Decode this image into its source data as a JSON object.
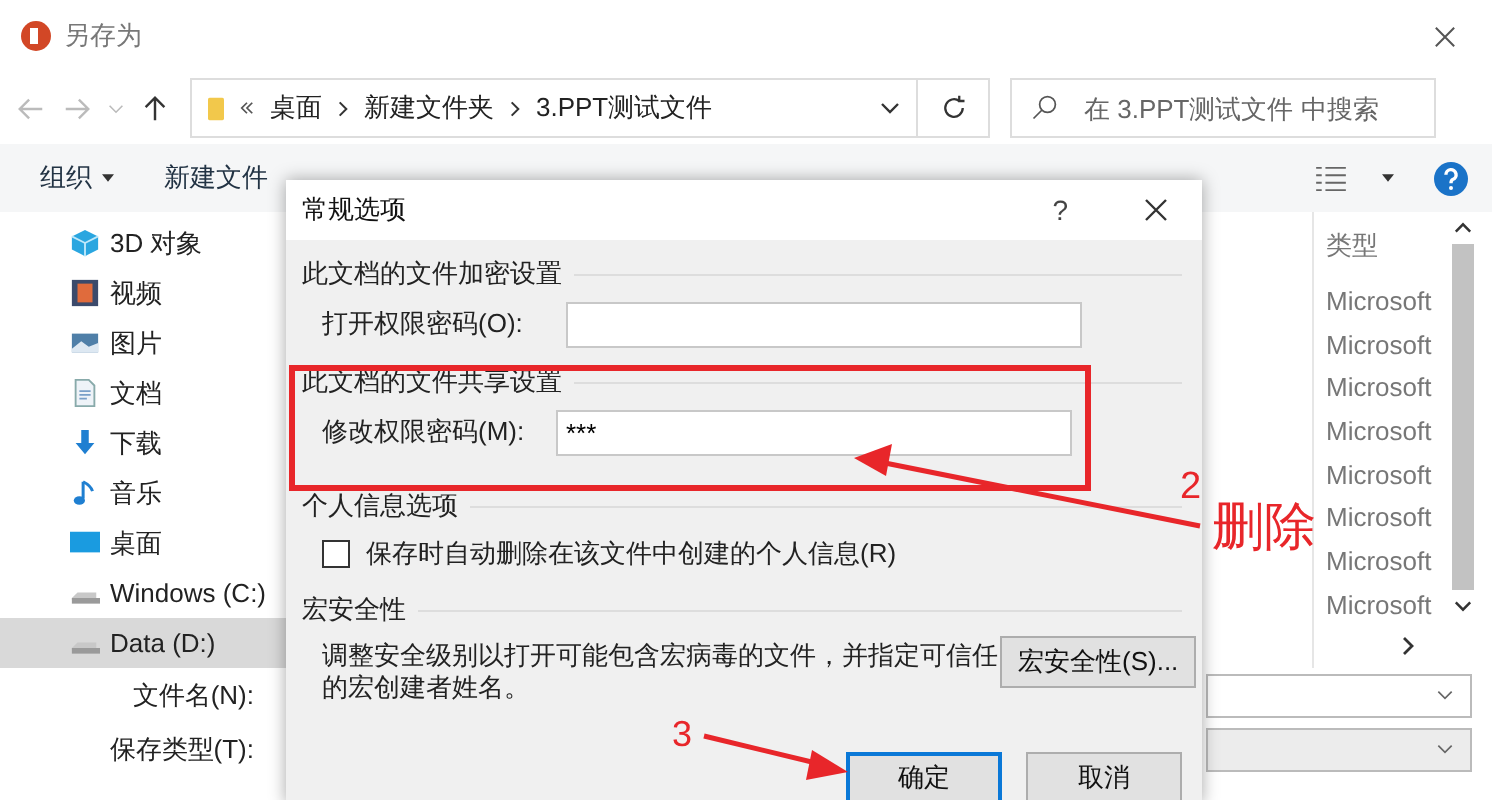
{
  "window": {
    "title": "另存为"
  },
  "address": {
    "crumbs": [
      "桌面",
      "新建文件夹",
      "3.PPT测试文件"
    ]
  },
  "search": {
    "placeholder": "在 3.PPT测试文件 中搜索"
  },
  "toolbar": {
    "organize": "组织",
    "new_folder": "新建文件"
  },
  "sidebar": {
    "items": [
      {
        "label": "3D 对象",
        "kind": "cube",
        "selected": false
      },
      {
        "label": "视频",
        "kind": "video",
        "selected": false
      },
      {
        "label": "图片",
        "kind": "pictures",
        "selected": false
      },
      {
        "label": "文档",
        "kind": "documents",
        "selected": false
      },
      {
        "label": "下载",
        "kind": "downloads",
        "selected": false
      },
      {
        "label": "音乐",
        "kind": "music",
        "selected": false
      },
      {
        "label": "桌面",
        "kind": "desktop",
        "selected": false
      },
      {
        "label": "Windows (C:)",
        "kind": "drive",
        "selected": false
      },
      {
        "label": "Data (D:)",
        "kind": "drive",
        "selected": true
      }
    ]
  },
  "files": {
    "column_header": "类型",
    "rows": [
      "Microsoft",
      "Microsoft",
      "Microsoft",
      "Microsoft",
      "Microsoft",
      "Microsoft",
      "Microsoft",
      "Microsoft"
    ]
  },
  "bottom": {
    "filename_label": "文件名(N):",
    "type_label": "保存类型(T):"
  },
  "dialog": {
    "title": "常规选项",
    "help": "?",
    "encrypt_section": "此文档的文件加密设置",
    "open_password": {
      "label": "打开权限密码(O):"
    },
    "share_section": "此文档的文件共享设置",
    "modify_password": {
      "label": "修改权限密码(M):",
      "value": "***"
    },
    "privacy_section": "个人信息选项",
    "remove_info": {
      "label": "保存时自动删除在该文件中创建的个人信息(R)",
      "checked": false
    },
    "macro_section": "宏安全性",
    "macro_text": "调整安全级别以打开可能包含宏病毒的文件，并指定可信任的宏创建者姓名。",
    "macro_button": "宏安全性(S)...",
    "buttons": [
      {
        "label": "确定",
        "selected": true
      },
      {
        "label": "取消",
        "selected": false
      }
    ]
  },
  "annotations": {
    "step_delete": "2",
    "delete_note": "删除",
    "step_ok": "3"
  }
}
